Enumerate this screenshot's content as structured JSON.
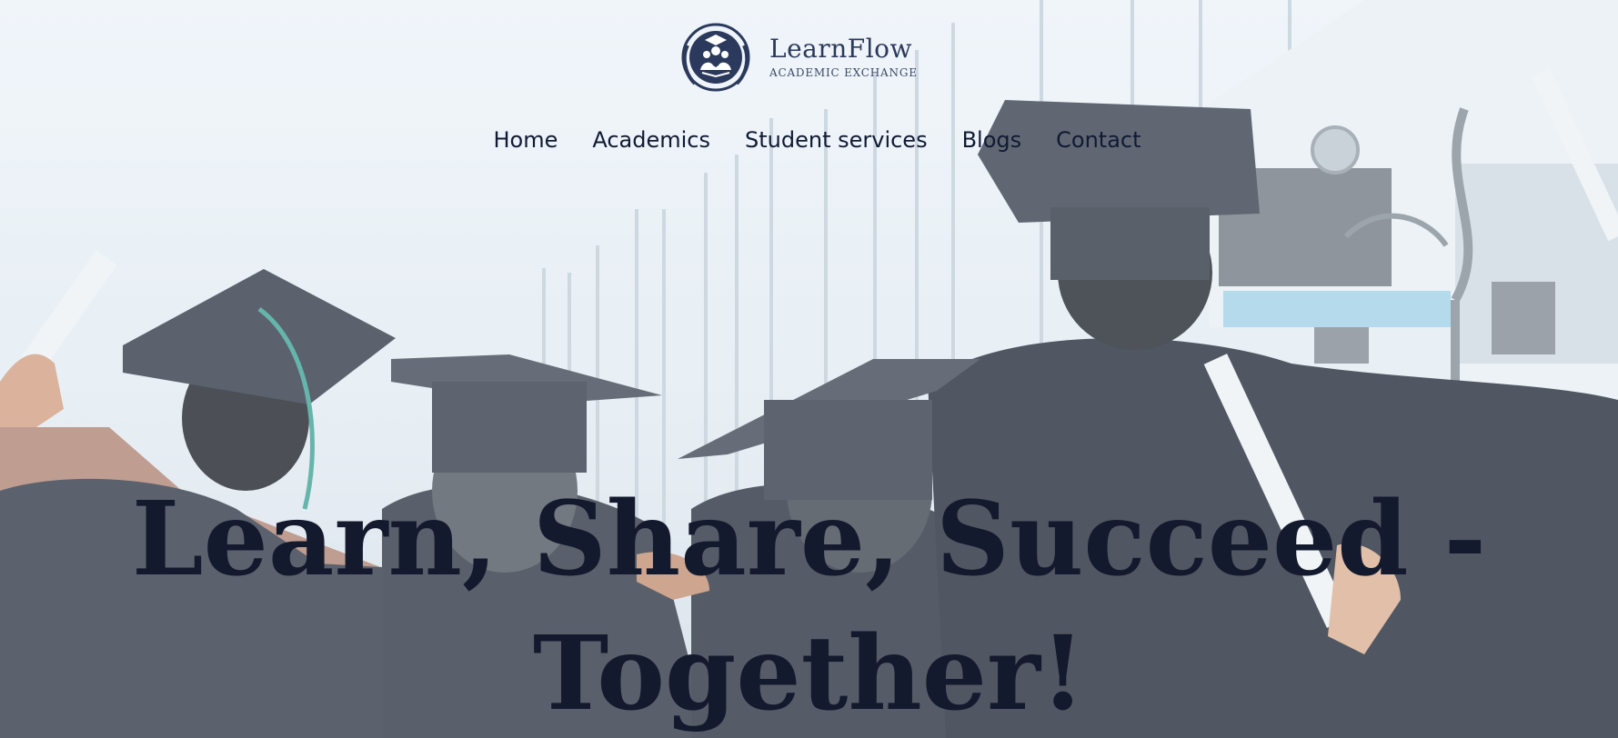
{
  "brand": {
    "name": "LearnFlow",
    "tagline": "Academic Exchange",
    "logo_icon": "graduates-laurel-emblem-icon",
    "color": "#2b3a5c"
  },
  "nav": {
    "items": [
      {
        "label": "Home"
      },
      {
        "label": "Academics"
      },
      {
        "label": "Student services"
      },
      {
        "label": "Blogs"
      },
      {
        "label": "Contact"
      }
    ]
  },
  "hero": {
    "headline": "Learn, Share, Succeed - Together!",
    "background_image": "graduates-in-caps-and-gowns-photo",
    "text_color": "#141a2e"
  }
}
